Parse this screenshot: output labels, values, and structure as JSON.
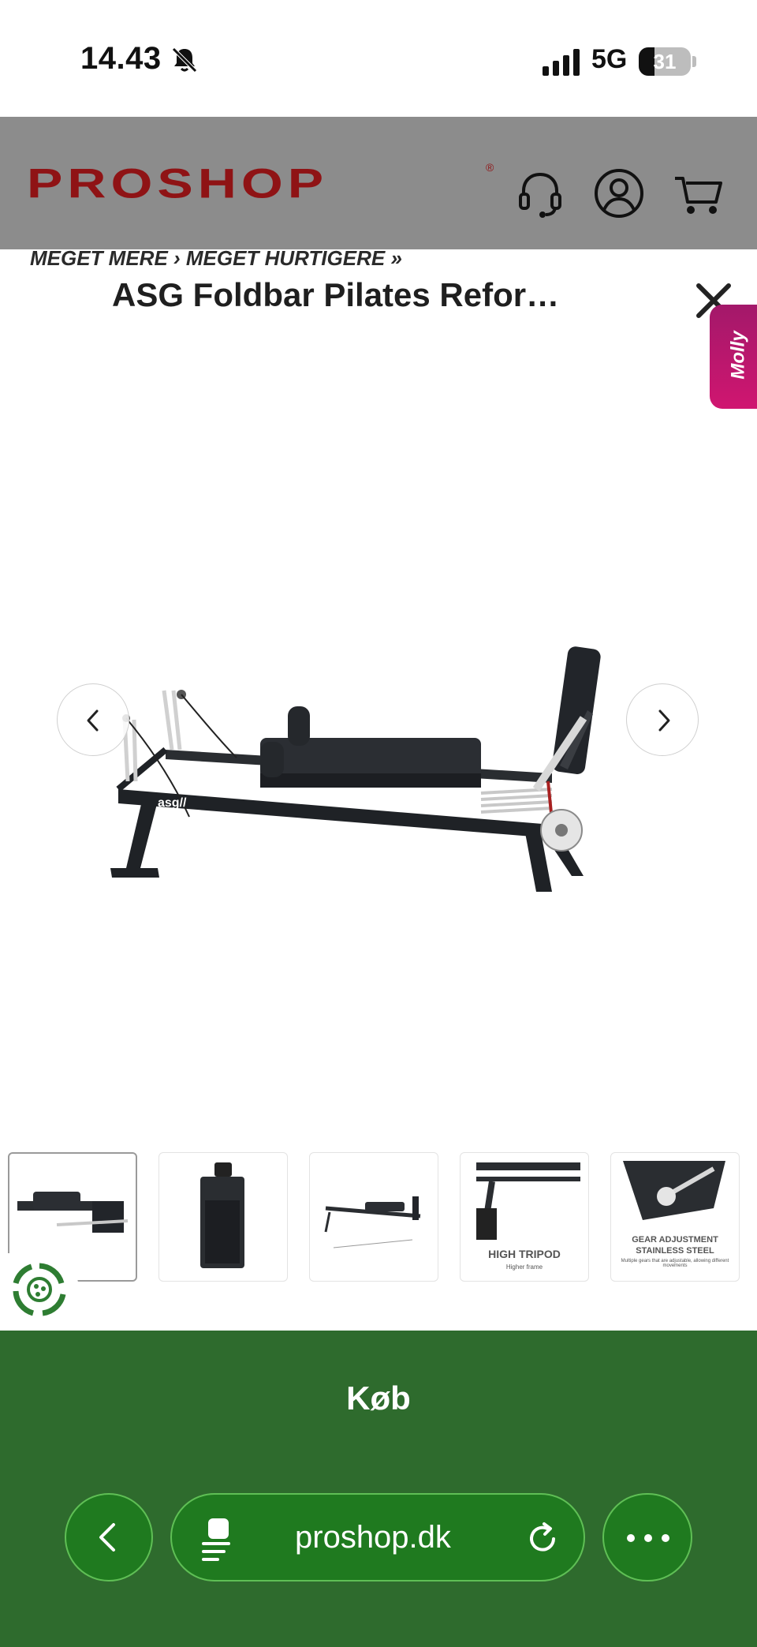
{
  "status_bar": {
    "time": "14.43",
    "network": "5G",
    "battery_percent": 31,
    "battery_label": "31",
    "icons": [
      "bell-muted-icon",
      "signal-icon"
    ]
  },
  "header": {
    "logo_text": "PROSHOP",
    "logo_reg": "®",
    "tagline": "MEGET MERE › MEGET HURTIGERE »",
    "brand_color": "#8f1315",
    "background_color": "#8c8c8c",
    "icons": [
      "headset-icon",
      "account-icon",
      "cart-icon"
    ]
  },
  "product": {
    "title": "ASG Foldbar Pilates Refor…",
    "image_brand_mark": "asg//"
  },
  "molly": {
    "label": "Molly"
  },
  "thumbnails": [
    {
      "caption": "",
      "selected": true
    },
    {
      "caption": "",
      "selected": false
    },
    {
      "caption": "",
      "selected": false
    },
    {
      "caption": "HIGH TRIPOD",
      "subcaption": "Higher frame",
      "selected": false
    },
    {
      "caption": "GEAR ADJUSTMENT",
      "caption2": "STAINLESS STEEL",
      "subcaption": "Multiple gears that are adjustable, allowing different movements",
      "selected": false
    }
  ],
  "buy_bar": {
    "label": "Køb",
    "background_color": "#2e6b2d"
  },
  "browser": {
    "url": "proshop.dk",
    "icons": [
      "back-chevron-icon",
      "page-icon",
      "reload-icon",
      "more-icon"
    ]
  }
}
